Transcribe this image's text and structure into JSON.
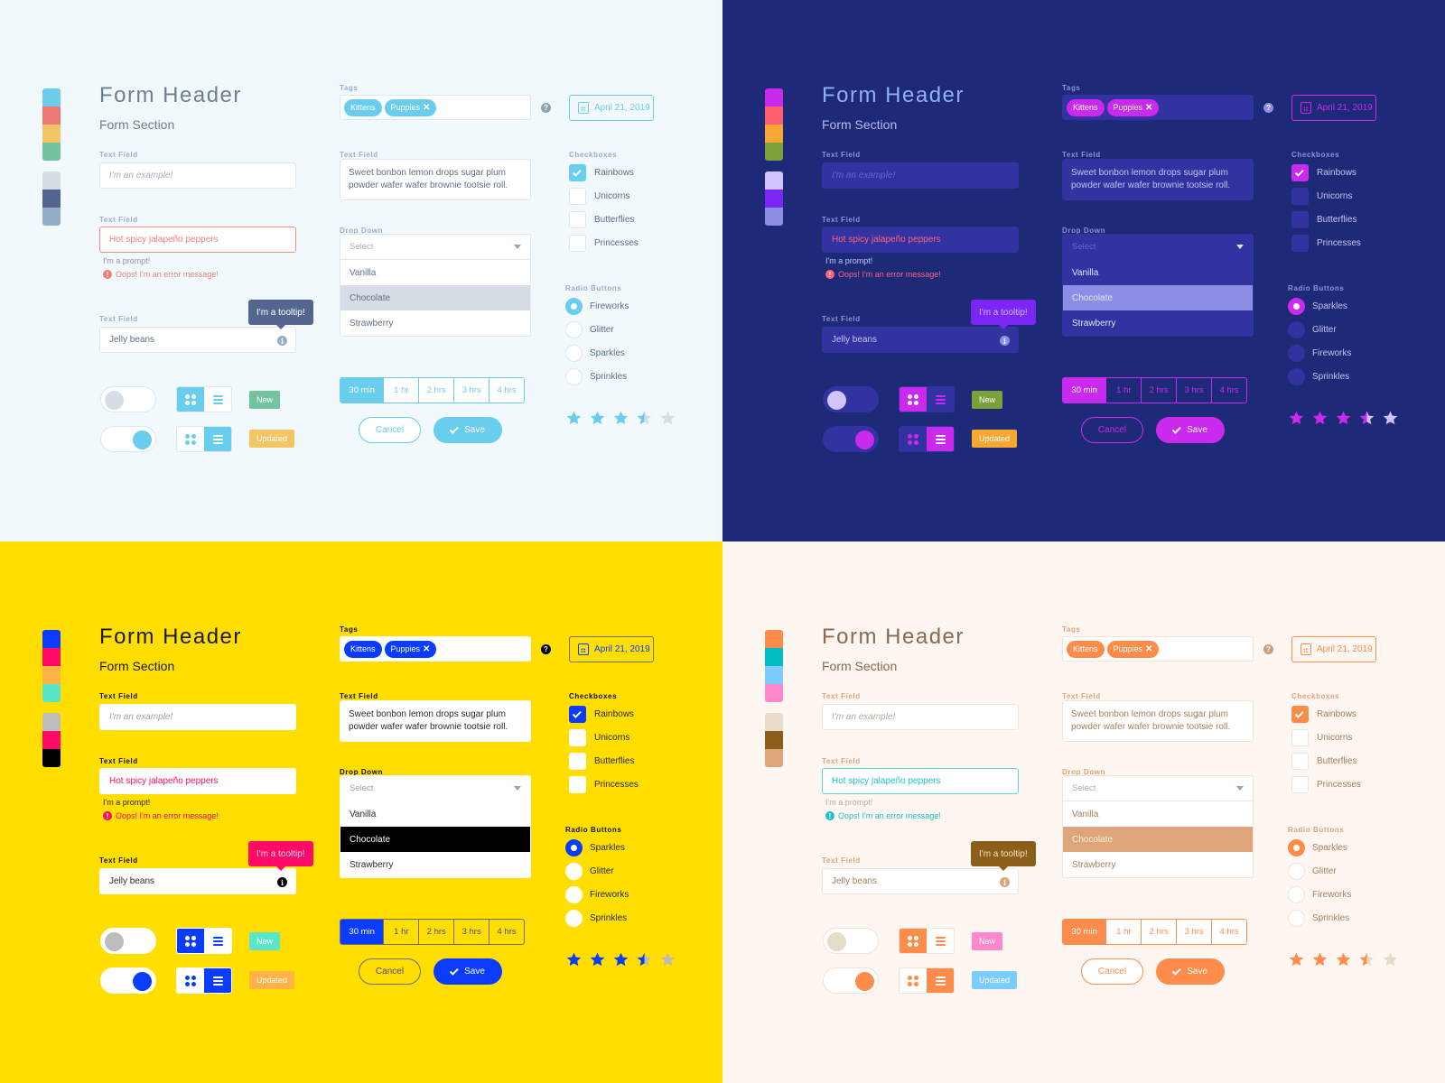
{
  "content": {
    "form_header": "Form Header",
    "form_section": "Form Section",
    "text_field_label": "Text Field",
    "text_field_1_placeholder": "I'm an example!",
    "text_field_2_value": "Hot spicy jalapeño peppers",
    "prompt": "I'm a prompt!",
    "error_message": "Oops! I'm an error message!",
    "text_field_3_value": "Jelly beans",
    "tooltip": "I'm a tooltip!",
    "badge_new": "New",
    "badge_updated": "Updated",
    "tags_label": "Tags",
    "tags": [
      "Kittens",
      "Puppies"
    ],
    "removable_tag_suffix": "✕",
    "date": "April 21, 2019",
    "textarea_label": "Text Field",
    "textarea_value": "Sweet bonbon lemon drops sugar plum powder wafer wafer brownie tootsie roll.",
    "dropdown_label": "Drop Down",
    "dropdown_placeholder": "Select",
    "dropdown_options": [
      "Vanilla",
      "Chocolate",
      "Strawberry"
    ],
    "dropdown_highlighted": "Chocolate",
    "duration_options": [
      "30 min",
      "1 hr",
      "2 hrs",
      "3 hrs",
      "4 hrs"
    ],
    "duration_selected": "30 min",
    "cancel_label": "Cancel",
    "save_label": "Save",
    "checkboxes_label": "Checkboxes",
    "checkboxes": [
      {
        "label": "Rainbows",
        "checked": true
      },
      {
        "label": "Unicorns",
        "checked": false
      },
      {
        "label": "Butterflies",
        "checked": false
      },
      {
        "label": "Princesses",
        "checked": false
      }
    ],
    "radio_label": "Radio Buttons",
    "rating": {
      "value": 3.5,
      "max": 5
    }
  },
  "themes": [
    {
      "name": "light-sky",
      "bg": "#f2f9fd",
      "swatches_primary": [
        "#6ccded",
        "#ec7a73",
        "#f4c565",
        "#74c39f"
      ],
      "swatches_secondary": [
        "#d7dde5",
        "#546690",
        "#93afc7"
      ],
      "header": "#6f7f90",
      "section": "#6f7f90",
      "label": "#96aecb",
      "field_bg": "#ffffff",
      "field_border": "#dfe8f0",
      "field_text": "#5e6e86",
      "placeholder": "#a5b2c0",
      "error_color": "#ef7f7b",
      "error_border": "#ef8b87",
      "prompt": "#8b96a3",
      "tooltip_bg": "#546690",
      "tooltip_text": "#ffffff",
      "info_bg": "#93afc7",
      "accent": "#69cdee",
      "accent_text": "#69cdee",
      "toggle_off_track": "#ffffff",
      "toggle_off_knob": "#d7dde5",
      "toggle_on_track": "#ffffff",
      "toggle_border": "#dde7ef",
      "seg_inactive_bg": "#ffffff",
      "seg_inactive_icon": "#69cdee",
      "badge_new": "#74c39f",
      "badge_updated": "#f4c565",
      "tag_bg": "#69cdee",
      "help_bg": "#93a3b5",
      "dd_highlight_bg": "#d7dde5",
      "dd_highlight_text": "#5e6e86",
      "dd_option_text": "#5e6e86",
      "dd_placeholder": "#a5b2c0",
      "cb_bg": "#ffffff",
      "cb_border": "#dde7ef",
      "cb_text": "#5e6e86",
      "star_off": "#d7dde5",
      "radios": [
        "Fireworks",
        "Glitter",
        "Sparkles",
        "Sprinkles"
      ]
    },
    {
      "name": "dark-indigo",
      "bg": "#1e2a78",
      "swatches_primary": [
        "#c92aee",
        "#ff5f6a",
        "#f6a830",
        "#7ca03a"
      ],
      "swatches_secondary": [
        "#d1c4fb",
        "#7b26f5",
        "#8c8ee6"
      ],
      "header": "#8fb0f0",
      "section": "#bcb8f2",
      "label": "#8f92d8",
      "field_bg": "#3232a0",
      "field_border": "#3232a0",
      "field_text": "#c6c3f4",
      "placeholder": "#6d5ee6",
      "error_color": "#ff6379",
      "error_border": "#3232a0",
      "prompt": "#c6c3f4",
      "tooltip_bg": "#7b26f5",
      "tooltip_text": "#c9b6fb",
      "info_bg": "#8c8ee6",
      "accent": "#c92aee",
      "accent_text": "#c92aee",
      "toggle_off_track": "#3232a0",
      "toggle_off_knob": "#d1c4fb",
      "toggle_on_track": "#3232a0",
      "toggle_border": "#3232a0",
      "seg_inactive_bg": "#3232a0",
      "seg_inactive_icon": "#c92aee",
      "badge_new": "#7ca03a",
      "badge_updated": "#f6a830",
      "tag_bg": "#c92aee",
      "help_bg": "#8c8ee6",
      "dd_highlight_bg": "#8c8ee6",
      "dd_highlight_text": "#e6e4fb",
      "dd_option_text": "#e6e4fb",
      "dd_placeholder": "#6d5ee6",
      "cb_bg": "#3232a0",
      "cb_border": "#3232a0",
      "cb_text": "#c6c3f4",
      "star_off": "#d1c4fb",
      "radios": [
        "Sparkles",
        "Glitter",
        "Fireworks",
        "Sprinkles"
      ]
    },
    {
      "name": "yellow-bold",
      "bg": "#ffde00",
      "swatches_primary": [
        "#0a3cff",
        "#ff0a66",
        "#ffb347",
        "#5ae6c8"
      ],
      "swatches_secondary": [
        "#bcbcbc",
        "#ff0a66",
        "#000000"
      ],
      "header": "#1a1a1a",
      "section": "#1a1a1a",
      "label": "#111111",
      "field_bg": "#ffffff",
      "field_border": "#ffffff",
      "field_text": "#2a2a2a",
      "placeholder": "#a0a0a0",
      "error_color": "#ff0a66",
      "error_border": "#ffffff",
      "prompt": "#2a2a2a",
      "tooltip_bg": "#ff0a66",
      "tooltip_text": "#ffd0e1",
      "info_bg": "#000000",
      "accent": "#0a3cff",
      "accent_text": "#0a3cff",
      "toggle_off_track": "#ffffff",
      "toggle_off_knob": "#bcbcbc",
      "toggle_on_track": "#ffffff",
      "toggle_border": "#ffffff",
      "seg_inactive_bg": "#ffffff",
      "seg_inactive_icon": "#0a3cff",
      "badge_new": "#5ae6c8",
      "badge_updated": "#ffb347",
      "tag_bg": "#0a3cff",
      "help_bg": "#000000",
      "dd_highlight_bg": "#000000",
      "dd_highlight_text": "#ffffff",
      "dd_option_text": "#2a2a2a",
      "dd_placeholder": "#a0a0a0",
      "cb_bg": "#ffffff",
      "cb_border": "#ffffff",
      "cb_text": "#2a2a2a",
      "star_off": "#bcbcbc",
      "seg_border": "#6d6d7a",
      "seg_text": "#4a4a8a",
      "radios": [
        "Sparkles",
        "Glitter",
        "Fireworks",
        "Sprinkles"
      ]
    },
    {
      "name": "peach-warm",
      "bg": "#fdf6f1",
      "swatches_primary": [
        "#ff8c4b",
        "#00bfc4",
        "#7ccdff",
        "#ff88cc"
      ],
      "swatches_secondary": [
        "#e6dcc8",
        "#8b5e1a",
        "#dea57a"
      ],
      "header": "#8b6a4f",
      "section": "#8b6a4f",
      "label": "#e0a27a",
      "field_bg": "#ffffff",
      "field_border": "#f3e4d8",
      "field_text": "#a5805a",
      "placeholder": "#b7a99b",
      "error_color": "#1ec3c7",
      "error_border": "#5fd3d6",
      "prompt": "#b9ada1",
      "tooltip_bg": "#8b5e1a",
      "tooltip_text": "#f5dfc4",
      "info_bg": "#dea57a",
      "accent": "#ff8c4b",
      "accent_text": "#ff8c4b",
      "toggle_off_track": "#ffffff",
      "toggle_off_knob": "#e6dcc8",
      "toggle_on_track": "#ffffff",
      "toggle_border": "#f3e4d8",
      "seg_inactive_bg": "#ffffff",
      "seg_inactive_icon": "#ff8c4b",
      "badge_new": "#ff88cc",
      "badge_updated": "#7ccdff",
      "tag_bg": "#ff8c4b",
      "help_bg": "#c99f7f",
      "dd_highlight_bg": "#dea57a",
      "dd_highlight_text": "#fdf0e6",
      "dd_option_text": "#a5805a",
      "dd_placeholder": "#b7a99b",
      "cb_bg": "#ffffff",
      "cb_border": "#f3e4d8",
      "cb_text": "#a5805a",
      "star_off": "#e6dcc8",
      "radios": [
        "Sparkles",
        "Glitter",
        "Fireworks",
        "Sprinkles"
      ]
    }
  ]
}
